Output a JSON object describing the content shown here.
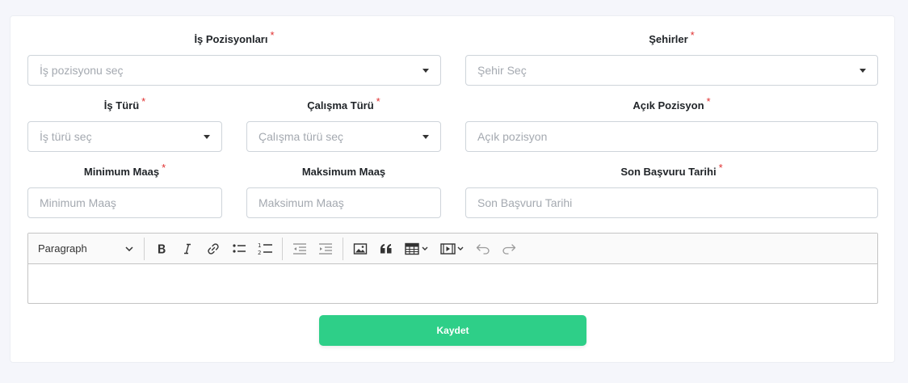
{
  "form": {
    "position": {
      "label": "İş Pozisyonları",
      "required": "*",
      "placeholder": "İş pozisyonu seç"
    },
    "cities": {
      "label": "Şehirler",
      "required": "*",
      "placeholder": "Şehir Seç"
    },
    "job_type": {
      "label": "İş Türü",
      "required": "*",
      "placeholder": "İş türü seç"
    },
    "work_type": {
      "label": "Çalışma Türü",
      "required": "*",
      "placeholder": "Çalışma türü seç"
    },
    "open_positions": {
      "label": "Açık Pozisyon",
      "required": "*",
      "placeholder": "Açık pozisyon"
    },
    "min_salary": {
      "label": "Minimum Maaş",
      "required": "*",
      "placeholder": "Minimum Maaş"
    },
    "max_salary": {
      "label": "Maksimum Maaş",
      "placeholder": "Maksimum Maaş"
    },
    "deadline": {
      "label": "Son Başvuru Tarihi",
      "required": "*",
      "placeholder": "Son Başvuru Tarihi"
    }
  },
  "editor": {
    "heading_select": "Paragraph",
    "tools": [
      "bold-icon",
      "italic-icon",
      "link-icon",
      "bulleted-list-icon",
      "numbered-list-icon",
      "outdent-icon",
      "indent-icon",
      "image-icon",
      "quote-icon",
      "table-icon",
      "media-icon",
      "undo-icon",
      "redo-icon"
    ]
  },
  "actions": {
    "save_label": "Kaydet"
  },
  "colors": {
    "primary": "#2ecf88",
    "required": "#e03131",
    "placeholder": "#a4a9b0",
    "page_bg": "#f5f6fb"
  }
}
